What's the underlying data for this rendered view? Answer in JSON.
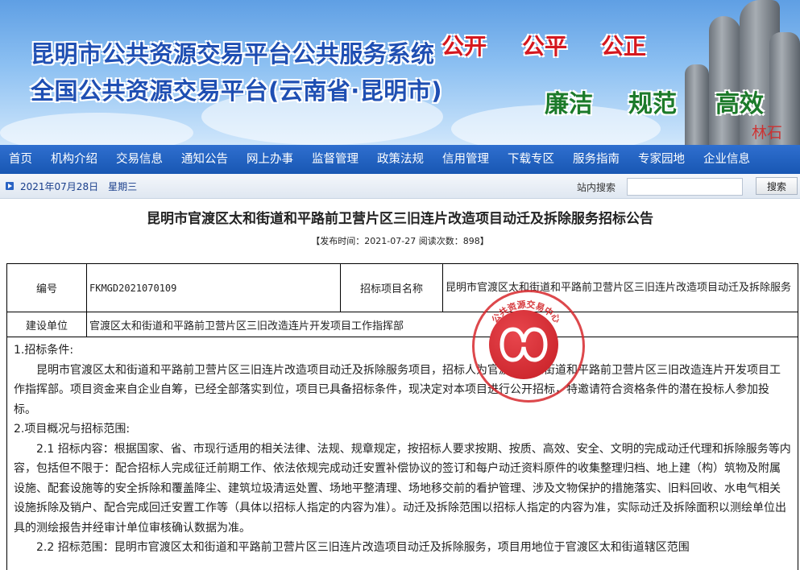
{
  "header": {
    "title_line1": "昆明市公共资源交易平台公共服务系统",
    "title_line2": "全国公共资源交易平台(云南省·昆明市)",
    "slogans_top": [
      "公开",
      "公平",
      "公正"
    ],
    "slogans_bottom": [
      "廉洁",
      "规范",
      "高效"
    ],
    "stone_text": "林石"
  },
  "nav": {
    "items": [
      "首页",
      "机构介绍",
      "交易信息",
      "通知公告",
      "网上办事",
      "监督管理",
      "政策法规",
      "信用管理",
      "下载专区",
      "服务指南",
      "专家园地",
      "企业信息"
    ]
  },
  "subbar": {
    "date": "2021年07月28日",
    "weekday": "星期三",
    "search_label": "站内搜索",
    "search_value": "",
    "search_button": "搜索"
  },
  "article": {
    "title": "昆明市官渡区太和街道和平路前卫营片区三旧连片改造项目动迁及拆除服务招标公告",
    "meta": "【发布时间：2021-07-27 阅读次数：898】",
    "table": {
      "code_label": "编号",
      "code_value": "FKMGD2021070109",
      "project_label": "招标项目名称",
      "project_value": "昆明市官渡区太和街道和平路前卫营片区三旧连片改造项目动迁及拆除服务",
      "unit_label": "建设单位",
      "unit_value": "官渡区太和街道和平路前卫营片区三旧改造连片开发项目工作指挥部"
    },
    "s1_heading": "1.招标条件:",
    "s1_text": "昆明市官渡区太和街道和平路前卫营片区三旧连片改造项目动迁及拆除服务项目，招标人为官渡区太和街道和平路前卫营片区三旧改造连片开发项目工作指挥部。项目资金来自企业自筹，已经全部落实到位，项目已具备招标条件，现决定对本项目进行公开招标，特邀请符合资格条件的潜在投标人参加投标。",
    "s2_heading": "2.项目概况与招标范围:",
    "s21_text": "2.1 招标内容：根据国家、省、市现行适用的相关法律、法规、规章规定，按招标人要求按期、按质、高效、安全、文明的完成动迁代理和拆除服务等内容，包括但不限于：配合招标人完成征迁前期工作、依法依规完成动迁安置补偿协议的签订和每户动迁资料原件的收集整理归档、地上建（构）筑物及附属设施、配套设施等的安全拆除和覆盖降尘、建筑垃圾清运处置、场地平整清理、场地移交前的看护管理、涉及文物保护的措施落实、旧料回收、水电气相关设施拆除及销户、配合完成回迁安置工作等（具体以招标人指定的内容为准）。动迁及拆除范围以招标人指定的内容为准，实际动迁及拆除面积以测绘单位出具的测绘报告并经审计单位审核确认数据为准。",
    "s22_text": "2.2 招标范围：昆明市官渡区太和街道和平路前卫营片区三旧连片改造项目动迁及拆除服务，项目用地位于官渡区太和街道辖区范围"
  },
  "seal": {
    "text": "公共资源交易中心"
  }
}
